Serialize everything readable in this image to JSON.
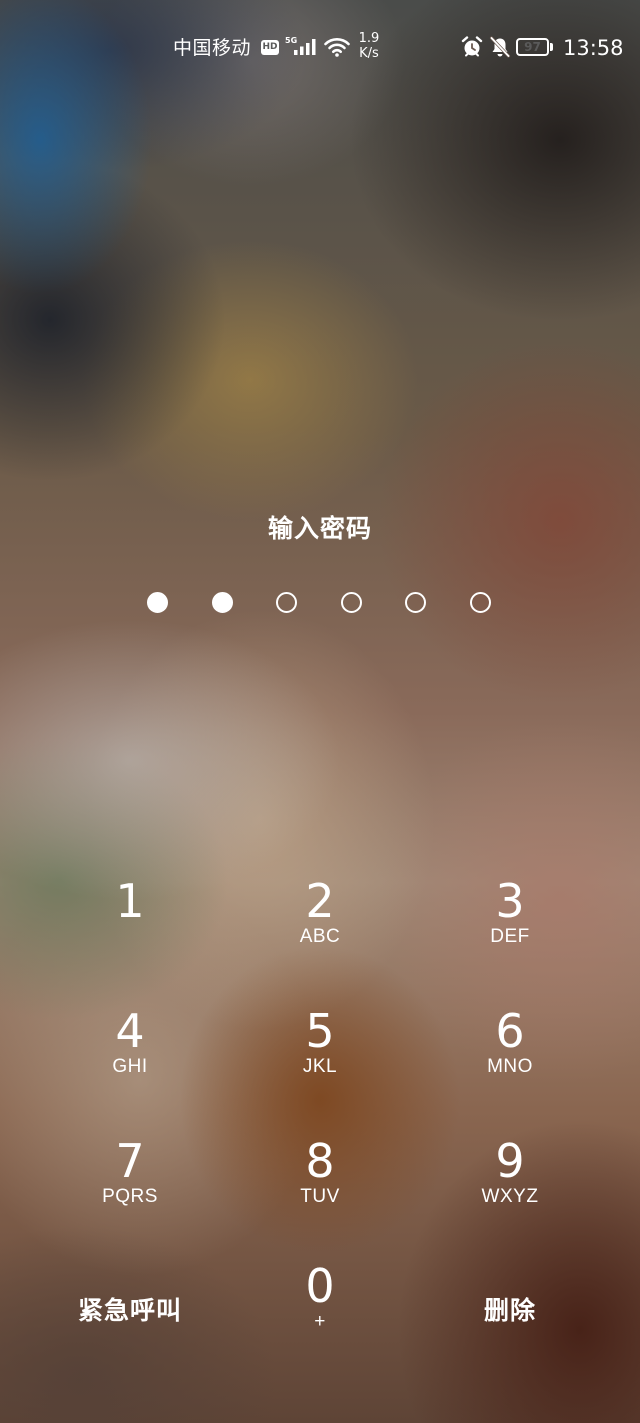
{
  "status_bar": {
    "carrier": "中国移动",
    "hd_badge": "HD",
    "network_type": "5G",
    "net_speed_value": "1.9",
    "net_speed_unit": "K/s",
    "battery_level": "97",
    "time": "13:58",
    "icons": [
      "hd-icon",
      "signal-icon",
      "wifi-icon",
      "alarm-icon",
      "mute-icon",
      "battery-icon"
    ]
  },
  "lock": {
    "prompt": "输入密码",
    "pin_length": 6,
    "entered_digits": 2
  },
  "keypad": {
    "keys": [
      {
        "digit": "1",
        "letters": ""
      },
      {
        "digit": "2",
        "letters": "ABC"
      },
      {
        "digit": "3",
        "letters": "DEF"
      },
      {
        "digit": "4",
        "letters": "GHI"
      },
      {
        "digit": "5",
        "letters": "JKL"
      },
      {
        "digit": "6",
        "letters": "MNO"
      },
      {
        "digit": "7",
        "letters": "PQRS"
      },
      {
        "digit": "8",
        "letters": "TUV"
      },
      {
        "digit": "9",
        "letters": "WXYZ"
      }
    ],
    "emergency_call": "紧急呼叫",
    "zero": {
      "digit": "0",
      "letters": "+"
    },
    "delete": "删除"
  }
}
